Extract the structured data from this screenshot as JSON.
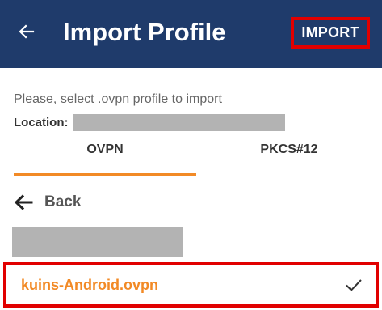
{
  "appbar": {
    "title": "Import Profile",
    "import_label": "IMPORT",
    "back_icon": "arrow-left-icon",
    "background_color": "#1f3b6b",
    "highlight_color": "#e10000"
  },
  "content": {
    "instructions": "Please, select .ovpn profile to import",
    "location_label": "Location:"
  },
  "tabs": [
    {
      "label": "OVPN",
      "active": true
    },
    {
      "label": "PKCS#12",
      "active": false
    }
  ],
  "accent_color": "#f28a26",
  "file_list": {
    "back_label": "Back",
    "back_icon": "arrow-left-icon",
    "items": [
      {
        "name": "kuins-Android.ovpn",
        "selected": true,
        "icon": "checkmark-icon"
      }
    ]
  }
}
